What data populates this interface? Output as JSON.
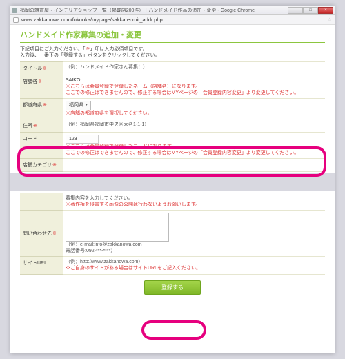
{
  "window": {
    "title": "福岡の雑貨屋・インテリアショップ一覧（掲載店200件）｜ハンドメイド作品の追加・変更 - Google Chrome",
    "url": "www.zakkanowa.com/fukuoka/mypage/sakkarecruit_addr.php"
  },
  "page": {
    "title": "ハンドメイド作家募集の追加・変更",
    "instr1": "下記項目にご入力ください。「",
    "instr_req": "※",
    "instr2": "」印は入力必須項目です。",
    "instr3": "入力後、一番下の「登録する」ボタンをクリックしてください。"
  },
  "rows": {
    "title_label": "タイトル",
    "title_hint": "（例：ハンドメイド作家さん募集！）",
    "shop_label": "店舗名",
    "shop_value": "SAIKO",
    "shop_red1": "※こちらは会員登録で登録したネーム（店舗名）になります。",
    "shop_red2": "ここでの修正はできませんので、修正する場合はMYページの「会員登録内容変更」より変更してください。",
    "pref_label": "都道府県",
    "pref_value": "福岡県",
    "pref_red": "※店舗の都道府県を選択してください。",
    "addr_label": "住所",
    "addr_hint": "（例：福岡県福岡市中央区大名1-1-1）",
    "code_label": "コード",
    "code_value": "123",
    "code_red1": "※こちらは会員登録で登録したコードになります。",
    "code_red2": "ここでの修正はできませんので、修正する場合はMYページの「会員登録内容変更」より変更してください。",
    "cat_label": "店舗カテゴリ",
    "desc_label": "",
    "desc_hint": "募集内容を入力してください。",
    "desc_red": "※著作権を侵害する画像の公開は行わないようお願いします。",
    "contact_label": "問い合わせ先",
    "contact_hint": "（例：e-mail:info@zakkanowa.com",
    "contact_hint2": "電話番号:092-***-****）",
    "url_label": "サイトURL",
    "url_hint": "（例：http://www.zakkanowa.com）",
    "url_red": "※ご自身のサイトがある場合はサイトURLをご記入ください。"
  },
  "submit": {
    "label": "登録する"
  }
}
